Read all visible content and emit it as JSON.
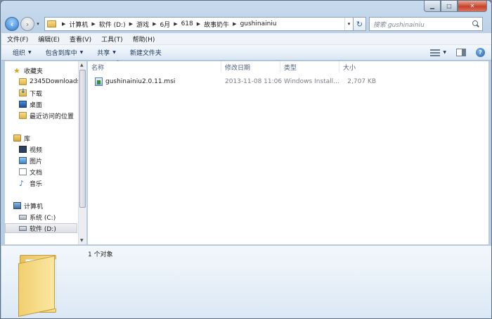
{
  "window": {
    "caption_min": "▁",
    "caption_max": "□",
    "caption_close": "✕"
  },
  "address": {
    "crumbs": [
      "计算机",
      "软件 (D:)",
      "游戏",
      "6月",
      "618",
      "故事奶牛",
      "gushinainiu"
    ]
  },
  "search": {
    "placeholder": "搜索 gushinainiu"
  },
  "menu": {
    "items": [
      "文件(F)",
      "编辑(E)",
      "查看(V)",
      "工具(T)",
      "帮助(H)"
    ]
  },
  "commands": {
    "organize": "组织",
    "include_library": "包含到库中",
    "share": "共享",
    "new_folder": "新建文件夹"
  },
  "navpane": {
    "favorites": "收藏夹",
    "fav_items": [
      "2345Downloads",
      "下载",
      "桌面",
      "最近访问的位置"
    ],
    "libraries": "库",
    "lib_items": [
      "视频",
      "图片",
      "文档",
      "音乐"
    ],
    "computer": "计算机",
    "drives": [
      "系统 (C:)",
      "软件 (D:)"
    ]
  },
  "columns": {
    "name": "名称",
    "modified": "修改日期",
    "type": "类型",
    "size": "大小"
  },
  "files": [
    {
      "name": "gushinainiu2.0.11.msi",
      "modified": "2013-11-08 11:06",
      "type": "Windows Install...",
      "size": "2,707 KB"
    }
  ],
  "details": {
    "count": "1 个对象"
  }
}
